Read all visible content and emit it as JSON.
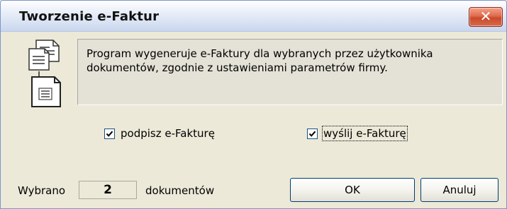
{
  "window": {
    "title": "Tworzenie e-Faktur",
    "close_symbol": "✕"
  },
  "info": {
    "message": "Program wygeneruje e-Faktury dla wybranych przez użytkownika dokumentów, zgodnie z ustawieniami parametrów firmy."
  },
  "options": {
    "sign": {
      "label": "podpisz e-Fakturę",
      "checked": true
    },
    "send": {
      "label": "wyślij e-Fakturę",
      "checked": true
    }
  },
  "footer": {
    "selected_label": "Wybrano",
    "selected_count": "2",
    "documents_label": "dokumentów",
    "ok_label": "OK",
    "cancel_label": "Anuluj"
  },
  "colors": {
    "accent": "#1C5180",
    "close": "#D2553A",
    "panel": "#E4E2D7"
  }
}
